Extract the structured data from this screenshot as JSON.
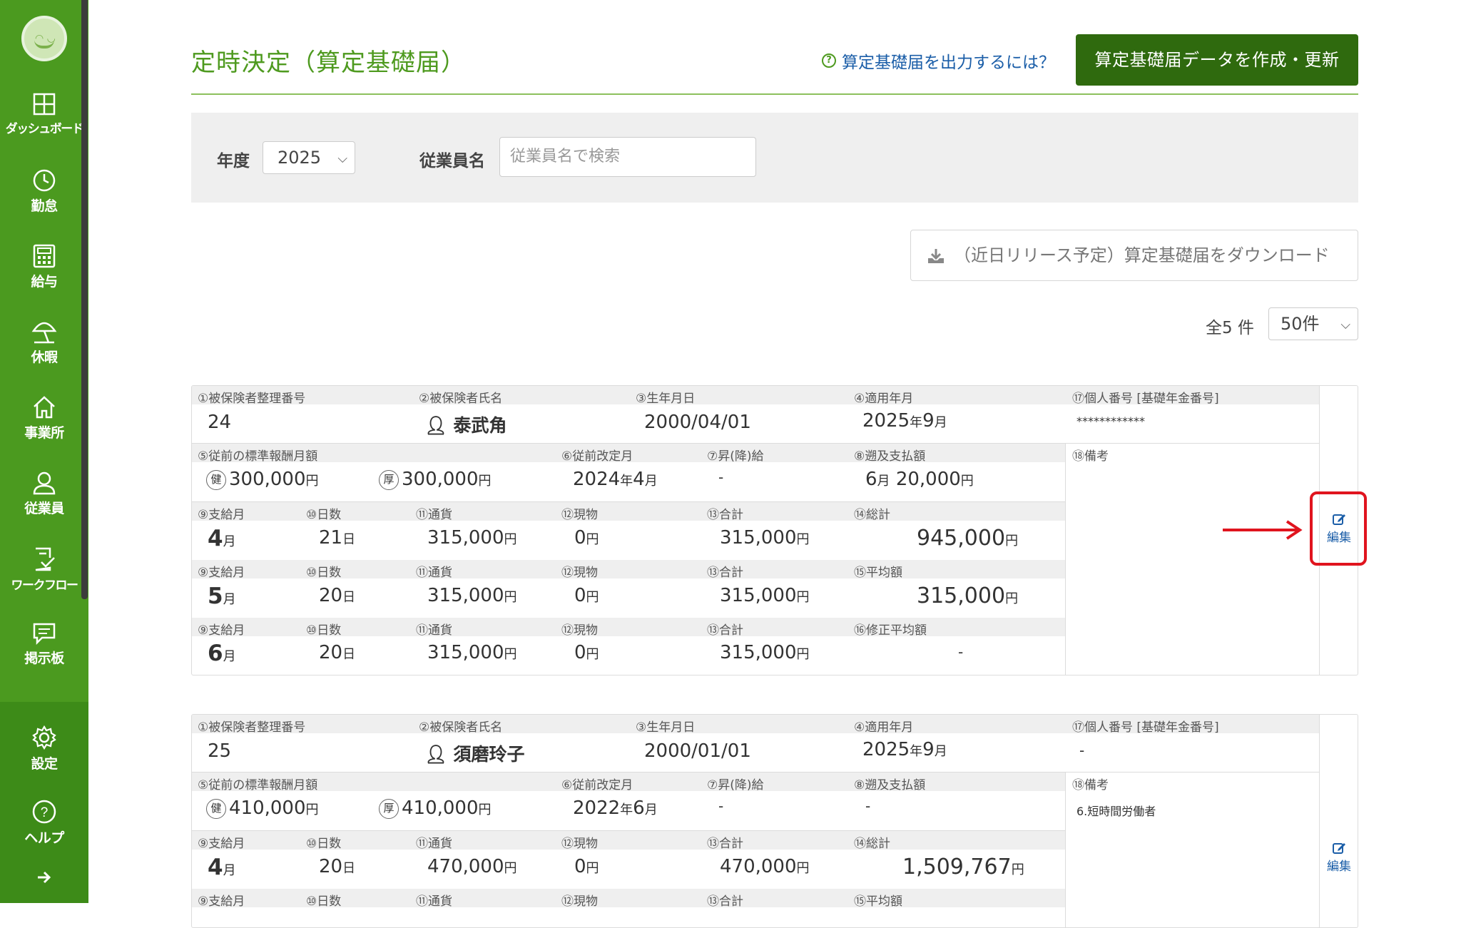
{
  "sidebar": {
    "items": [
      {
        "label": "ダッシュボード",
        "icon": "dashboard-icon"
      },
      {
        "label": "勤怠",
        "icon": "clock-icon"
      },
      {
        "label": "給与",
        "icon": "calculator-icon"
      },
      {
        "label": "休暇",
        "icon": "umbrella-icon"
      },
      {
        "label": "事業所",
        "icon": "home-icon"
      },
      {
        "label": "従業員",
        "icon": "person-icon"
      },
      {
        "label": "ワークフロー",
        "icon": "checklist-icon"
      },
      {
        "label": "掲示板",
        "icon": "message-icon"
      },
      {
        "label": "設定",
        "icon": "gear-icon"
      },
      {
        "label": "ヘルプ",
        "icon": "help-icon"
      }
    ],
    "expand_icon": "arrow-right-icon"
  },
  "header": {
    "title": "定時決定（算定基礎届）",
    "help_link": "算定基礎届を出力するには？",
    "create_button": "算定基礎届データを作成・更新"
  },
  "filter": {
    "year_label": "年度",
    "year_value": "2025",
    "employee_label": "従業員名",
    "employee_placeholder": "従業員名で検索"
  },
  "download_button": "（近日リリース予定）算定基礎届をダウンロード",
  "list": {
    "count_text": "全5 件",
    "per_page": "50件"
  },
  "labels": {
    "insured_no": "①被保険者整理番号",
    "insured_name": "②被保険者氏名",
    "birth": "③生年月日",
    "apply_month": "④適用年月",
    "my_number": "⑰個人番号 [基礎年金番号]",
    "prev_standard": "⑤従前の標準報酬月額",
    "prev_revision": "⑥従前改定月",
    "raise": "⑦昇(降)給",
    "retro": "⑧遡及支払額",
    "remarks": "⑱備考",
    "pay_month": "⑨支給月",
    "days": "⑩日数",
    "currency": "⑪通貨",
    "in_kind": "⑫現物",
    "subtotal": "⑬合計",
    "total": "⑭総計",
    "average": "⑮平均額",
    "adjusted_average": "⑯修正平均額",
    "health": "健",
    "pension": "厚",
    "edit": "編集",
    "unit_yen": "円",
    "unit_month": "月",
    "unit_day": "日",
    "unit_year": "年"
  },
  "records": [
    {
      "insured_no": "24",
      "name": "泰武角",
      "birth": "2000/04/01",
      "apply_year": "2025",
      "apply_month": "9",
      "my_number": "************",
      "prev_health": "300,000",
      "prev_pension": "300,000",
      "prev_revision_year": "2024",
      "prev_revision_month": "4",
      "raise": "-",
      "retro_month": "6",
      "retro_amount": "20,000",
      "remarks": "",
      "months": [
        {
          "month": "4",
          "days": "21",
          "currency": "315,000",
          "in_kind": "0",
          "subtotal": "315,000"
        },
        {
          "month": "5",
          "days": "20",
          "currency": "315,000",
          "in_kind": "0",
          "subtotal": "315,000"
        },
        {
          "month": "6",
          "days": "20",
          "currency": "315,000",
          "in_kind": "0",
          "subtotal": "315,000"
        }
      ],
      "total": "945,000",
      "average": "315,000",
      "adjusted_average": "-"
    },
    {
      "insured_no": "25",
      "name": "須磨玲子",
      "birth": "2000/01/01",
      "apply_year": "2025",
      "apply_month": "9",
      "my_number": "-",
      "prev_health": "410,000",
      "prev_pension": "410,000",
      "prev_revision_year": "2022",
      "prev_revision_month": "6",
      "raise": "-",
      "retro": "-",
      "remarks": "6.短時間労働者",
      "months": [
        {
          "month": "4",
          "days": "20",
          "currency": "470,000",
          "in_kind": "0",
          "subtotal": "470,000"
        }
      ],
      "total": "1,509,767"
    }
  ],
  "colors": {
    "sidebar": "#4b9a1f",
    "primary_button": "#2f6a0e",
    "title": "#4e9a1f",
    "link": "#1b5ea8",
    "highlight": "#e0141e"
  }
}
